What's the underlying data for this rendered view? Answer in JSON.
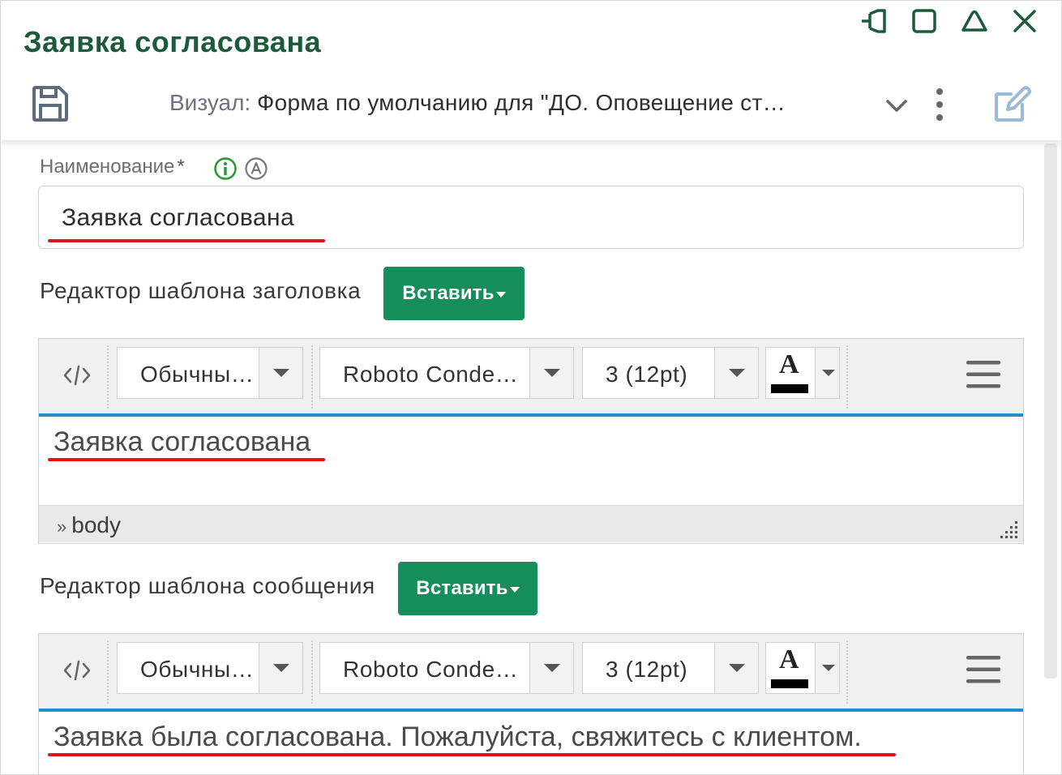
{
  "window": {
    "title": "Заявка согласована",
    "controls": [
      "pin-icon",
      "maximize-icon",
      "collapse-icon",
      "close-icon"
    ]
  },
  "toolbar": {
    "save_icon": "save-icon",
    "visual_label": "Визуал:",
    "visual_value": "Форма по умолчанию для \"ДО. Оповещение ст…",
    "more_icon": "kebab-icon",
    "edit_icon": "edit-icon"
  },
  "form": {
    "name_label": "Наименование",
    "required_mark": "*",
    "name_value": "Заявка согласована",
    "header_editor": {
      "label": "Редактор шаблона заголовка",
      "insert_label": "Вставить",
      "format_value": "Обычны…",
      "font_value": "Roboto Conde…",
      "size_value": "3 (12pt)",
      "color_letter": "A",
      "content": "Заявка согласована",
      "path": "body",
      "path_prefix": "»"
    },
    "message_editor": {
      "label": "Редактор шаблона сообщения",
      "insert_label": "Вставить",
      "format_value": "Обычны…",
      "font_value": "Roboto Conde…",
      "size_value": "3 (12pt)",
      "color_letter": "A",
      "content": "Заявка была согласована. Пожалуйста, свяжитесь с клиентом."
    }
  },
  "colors": {
    "title": "#1d5a3b",
    "accent_button": "#168e5b",
    "editor_focus": "#1f8fd0",
    "highlight_underline": "#e0131b",
    "info_icon": "#1f9b2f"
  }
}
